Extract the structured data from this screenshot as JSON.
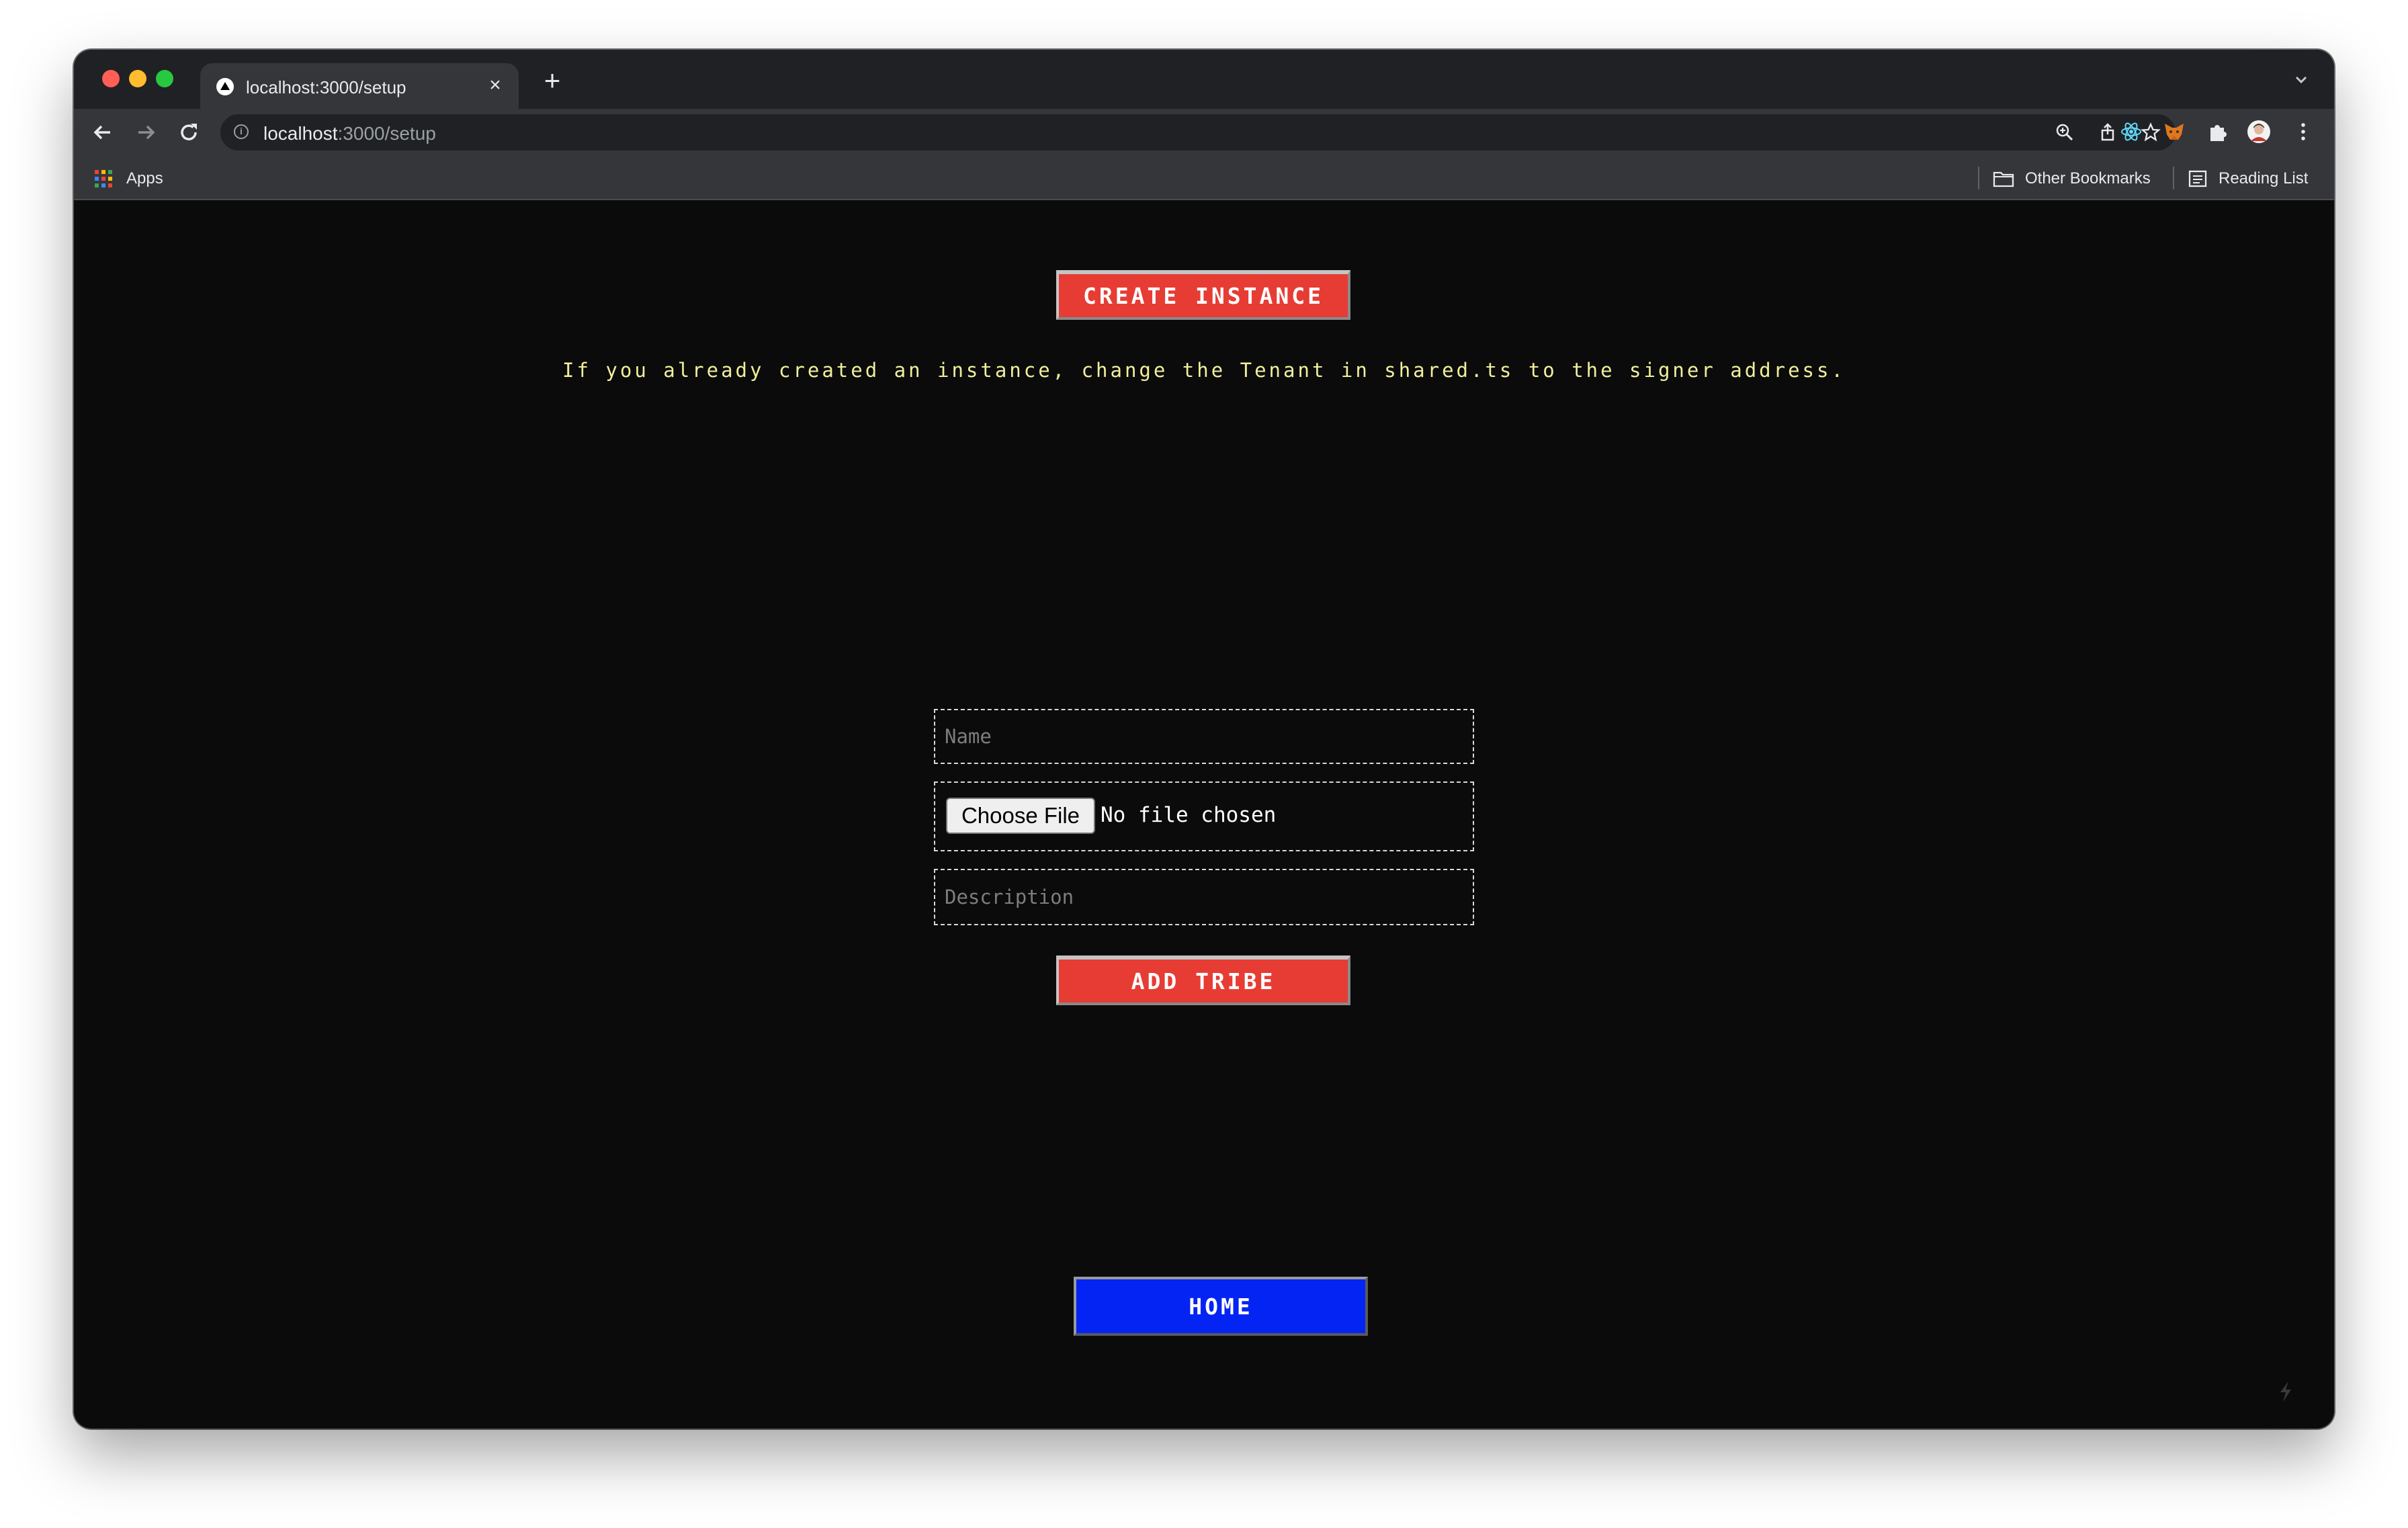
{
  "browser": {
    "tab": {
      "title": "localhost:3000/setup"
    },
    "address_bar": {
      "host": "localhost",
      "path": ":3000/setup"
    },
    "bookmarks": {
      "apps_label": "Apps",
      "other_bookmarks_label": "Other Bookmarks",
      "reading_list_label": "Reading List"
    },
    "icons": {
      "close_glyph": "×",
      "new_tab_glyph": "+",
      "info_glyph": "i"
    }
  },
  "page": {
    "create_button_label": "CREATE INSTANCE",
    "notice": "If you already created an instance, change the Tenant in shared.ts to the signer address.",
    "form": {
      "name_placeholder": "Name",
      "choose_file_label": "Choose File",
      "file_status": "No file chosen",
      "description_placeholder": "Description",
      "submit_label": "ADD TRIBE"
    },
    "home_button_label": "HOME"
  },
  "colors": {
    "page_background": "#0b0b0c",
    "red_button": "#e63c34",
    "blue_button": "#0424f4",
    "notice_text": "#f1ef9a"
  }
}
